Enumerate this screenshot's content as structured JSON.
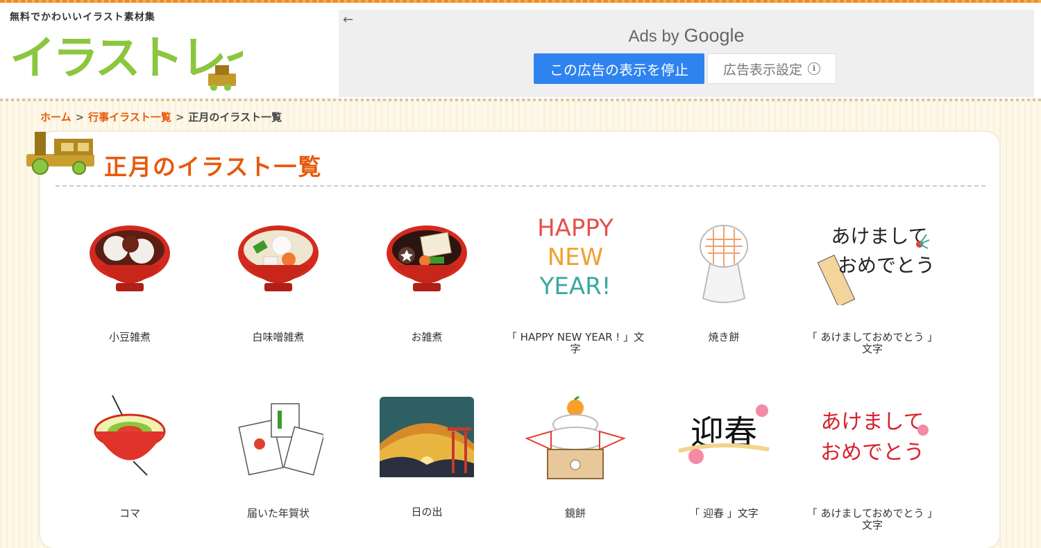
{
  "site": {
    "tagline": "無料でかわいいイラスト素材集",
    "logo_text": "イラストレイン"
  },
  "ad": {
    "back_icon": "arrow-left-icon",
    "ads_by_prefix": "Ads by",
    "ads_by_brand": "Google",
    "stop_label": "この広告の表示を停止",
    "settings_label": "広告表示設定",
    "info_icon": "info-icon",
    "stop_color": "#2f83ee"
  },
  "breadcrumb": {
    "items": [
      "ホーム",
      "行事イラスト一覧",
      "正月のイラスト一覧"
    ],
    "separator": ">"
  },
  "page": {
    "title": "正月のイラスト一覧",
    "accent": "#e8590c"
  },
  "items": [
    {
      "label": "小豆雑煮",
      "icon": "azuki-zoni-icon"
    },
    {
      "label": "白味噌雑煮",
      "icon": "shiromiso-zoni-icon"
    },
    {
      "label": "お雑煮",
      "icon": "ozoni-icon"
    },
    {
      "label": "「 HAPPY NEW YEAR ! 」文字",
      "icon": "happy-new-year-text-icon"
    },
    {
      "label": "焼き餅",
      "icon": "yakimochi-icon"
    },
    {
      "label": "「 あけましておめでとう 」文字",
      "icon": "akemashite-hagoita-icon"
    },
    {
      "label": "コマ",
      "icon": "koma-top-icon"
    },
    {
      "label": "届いた年賀状",
      "icon": "nengajo-cards-icon"
    },
    {
      "label": "日の出",
      "icon": "sunrise-torii-icon"
    },
    {
      "label": "鏡餅",
      "icon": "kagami-mochi-icon"
    },
    {
      "label": "「 迎春 」文字",
      "icon": "geishun-text-icon"
    },
    {
      "label": "「 あけましておめでとう 」文字",
      "icon": "akemashite-text-icon"
    }
  ],
  "art_text": {
    "hny_line1": "HAPPY",
    "hny_line2": "NEW",
    "hny_line3": "YEAR!",
    "ake_line1": "あけまして",
    "ake_line2": "おめでとう",
    "geishun": "迎春"
  }
}
